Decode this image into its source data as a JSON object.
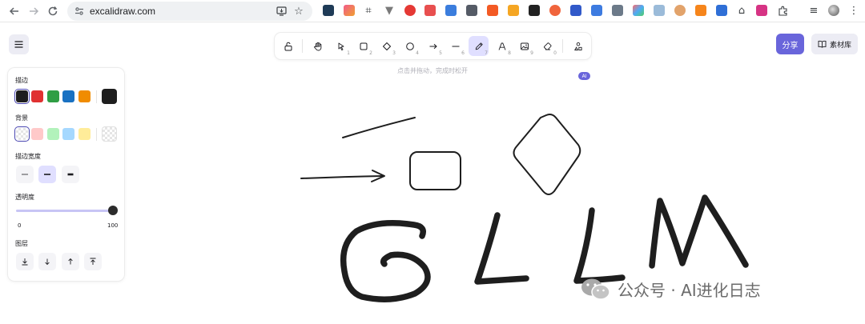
{
  "browser": {
    "url": "excalidraw.com"
  },
  "toolbar": {
    "tools": [
      {
        "name": "lock",
        "key": ""
      },
      {
        "name": "hand",
        "key": ""
      },
      {
        "name": "selection",
        "key": "1"
      },
      {
        "name": "rectangle",
        "key": "2"
      },
      {
        "name": "diamond",
        "key": "3"
      },
      {
        "name": "ellipse",
        "key": "4"
      },
      {
        "name": "arrow",
        "key": "5"
      },
      {
        "name": "line",
        "key": "6"
      },
      {
        "name": "freedraw",
        "key": "7"
      },
      {
        "name": "text",
        "key": "8"
      },
      {
        "name": "image",
        "key": "9"
      },
      {
        "name": "eraser",
        "key": "0"
      }
    ],
    "active_tool": "freedraw",
    "ai_badge": "AI"
  },
  "hint": "点击并拖动，完成时松开",
  "header": {
    "share_label": "分享",
    "library_label": "素材库"
  },
  "panel": {
    "stroke_label": "描边",
    "stroke_colors": [
      "#1e1e1e",
      "#e03131",
      "#2f9e44",
      "#1971c2",
      "#f08c00"
    ],
    "stroke_current": "#1e1e1e",
    "background_label": "背景",
    "background_colors": [
      "transparent",
      "#ffc9c9",
      "#b2f2bb",
      "#a5d8ff",
      "#ffec99"
    ],
    "stroke_width_label": "描边宽度",
    "stroke_width_selected": 1,
    "opacity_label": "透明度",
    "opacity_min": "0",
    "opacity_max": "100",
    "opacity_value": 100,
    "layers_label": "图层"
  },
  "watermark": {
    "text": "公众号 · AI进化日志"
  },
  "colors": {
    "accent": "#6965db",
    "accent_light": "#e0dfff",
    "ink": "#1e1e1e"
  }
}
